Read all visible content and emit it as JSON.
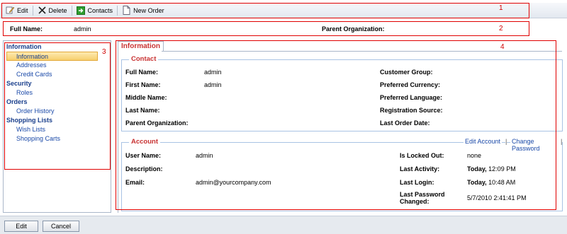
{
  "toolbar": {
    "edit": "Edit",
    "delete": "Delete",
    "contacts": "Contacts",
    "new_order": "New Order"
  },
  "header": {
    "full_name_label": "Full Name:",
    "full_name_value": "admin",
    "parent_org_label": "Parent Organization:",
    "parent_org_value": ""
  },
  "callouts": [
    "1",
    "2",
    "3",
    "4"
  ],
  "nav": {
    "groups": [
      {
        "label": "Information",
        "items": [
          "Information",
          "Addresses",
          "Credit Cards"
        ]
      },
      {
        "label": "Security",
        "items": [
          "Roles"
        ]
      },
      {
        "label": "Orders",
        "items": [
          "Order History"
        ]
      },
      {
        "label": "Shopping Lists",
        "items": [
          "Wish Lists",
          "Shopping Carts"
        ]
      }
    ],
    "selected": "Information"
  },
  "tab": {
    "label": "Information"
  },
  "contact": {
    "legend": "Contact",
    "full_name_label": "Full Name:",
    "full_name_value": "admin",
    "first_name_label": "First Name:",
    "first_name_value": "admin",
    "middle_name_label": "Middle Name:",
    "last_name_label": "Last Name:",
    "parent_org_label": "Parent Organization:",
    "customer_group_label": "Customer Group:",
    "preferred_currency_label": "Preferred Currency:",
    "preferred_language_label": "Preferred Language:",
    "registration_source_label": "Registration Source:",
    "last_order_date_label": "Last Order Date:"
  },
  "account": {
    "legend": "Account",
    "edit_link": "Edit Account",
    "change_password_link": "Change Password",
    "separator": "|",
    "user_name_label": "User Name:",
    "user_name_value": "admin",
    "description_label": "Description:",
    "email_label": "Email:",
    "email_value": "admin@yourcompany.com",
    "locked_label": "Is Locked Out:",
    "locked_value": "none",
    "last_activity_label": "Last Activity:",
    "last_activity_day": "Today,",
    "last_activity_time": " 12:09 PM",
    "last_login_label": "Last Login:",
    "last_login_day": "Today,",
    "last_login_time": " 10:48 AM",
    "last_password_label_1": "Last Password",
    "last_password_label_2": "Changed:",
    "last_password_value": "5/7/2010 2:41:41 PM"
  },
  "bottom": {
    "edit": "Edit",
    "cancel": "Cancel"
  },
  "colors": {
    "highlight": "#e00000",
    "link": "#1a49a8",
    "legend": "#c83232"
  },
  "icons": [
    "edit-icon",
    "delete-icon",
    "contacts-icon",
    "new-order-icon"
  ]
}
